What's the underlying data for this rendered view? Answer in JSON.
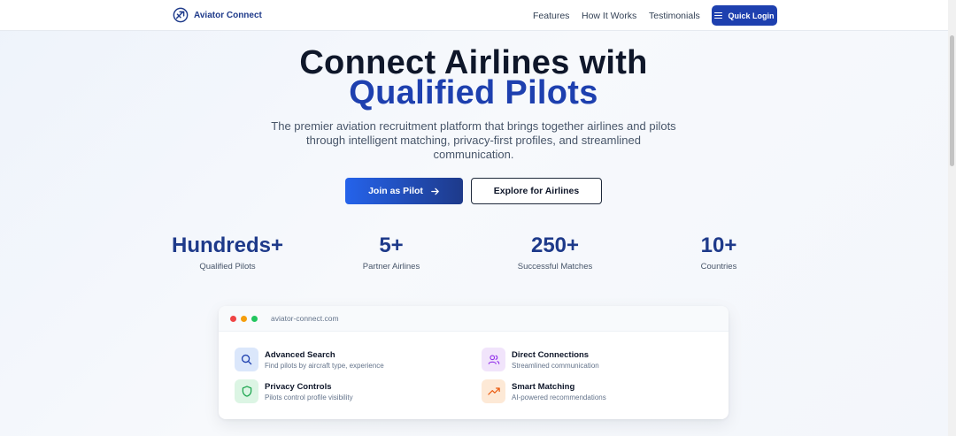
{
  "nav": {
    "brand": "Aviator Connect",
    "links": [
      "Features",
      "How It Works",
      "Testimonials"
    ],
    "login_label": "Quick Login"
  },
  "hero": {
    "title_line1": "Connect Airlines with",
    "title_line2": "Qualified Pilots",
    "subtitle": "The premier aviation recruitment platform that brings together airlines and pilots through intelligent matching, privacy-first profiles, and streamlined communication.",
    "primary_cta": "Join as Pilot",
    "secondary_cta": "Explore for Airlines"
  },
  "stats": [
    {
      "value": "Hundreds+",
      "label": "Qualified Pilots"
    },
    {
      "value": "5+",
      "label": "Partner Airlines"
    },
    {
      "value": "250+",
      "label": "Successful Matches"
    },
    {
      "value": "10+",
      "label": "Countries"
    }
  ],
  "preview": {
    "url": "aviator-connect.com",
    "features": [
      {
        "title": "Advanced Search",
        "desc": "Find pilots by aircraft type, experience",
        "icon": "search-icon"
      },
      {
        "title": "Direct Connections",
        "desc": "Streamlined communication",
        "icon": "users-icon"
      },
      {
        "title": "Privacy Controls",
        "desc": "Pilots control profile visibility",
        "icon": "shield-icon"
      },
      {
        "title": "Smart Matching",
        "desc": "AI-powered recommendations",
        "icon": "trend-up-icon"
      }
    ]
  },
  "colors": {
    "brand": "#1e40af",
    "brand_dark": "#1e3a8a",
    "text_dark": "#0f172a"
  }
}
